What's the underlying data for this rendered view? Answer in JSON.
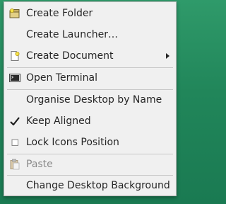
{
  "menu": {
    "items": [
      {
        "label": "Create Folder",
        "icon": "folder-new-icon"
      },
      {
        "label": "Create Launcher…",
        "icon": ""
      },
      {
        "label": "Create Document",
        "icon": "document-new-icon",
        "submenu": true
      },
      {
        "label": "Open Terminal",
        "icon": "terminal-icon"
      },
      {
        "label": "Organise Desktop by Name",
        "icon": ""
      },
      {
        "label": "Keep Aligned",
        "icon": "check-icon",
        "checked": true
      },
      {
        "label": "Lock Icons Position",
        "icon": "checkbox-icon",
        "checked": false
      },
      {
        "label": "Paste",
        "icon": "paste-icon",
        "disabled": true
      },
      {
        "label": "Change Desktop Background",
        "icon": ""
      }
    ]
  },
  "colors": {
    "desktop_background": "#21865a",
    "menu_background": "#f0f0f0",
    "text": "#262626",
    "disabled_text": "#8a8a8a"
  }
}
